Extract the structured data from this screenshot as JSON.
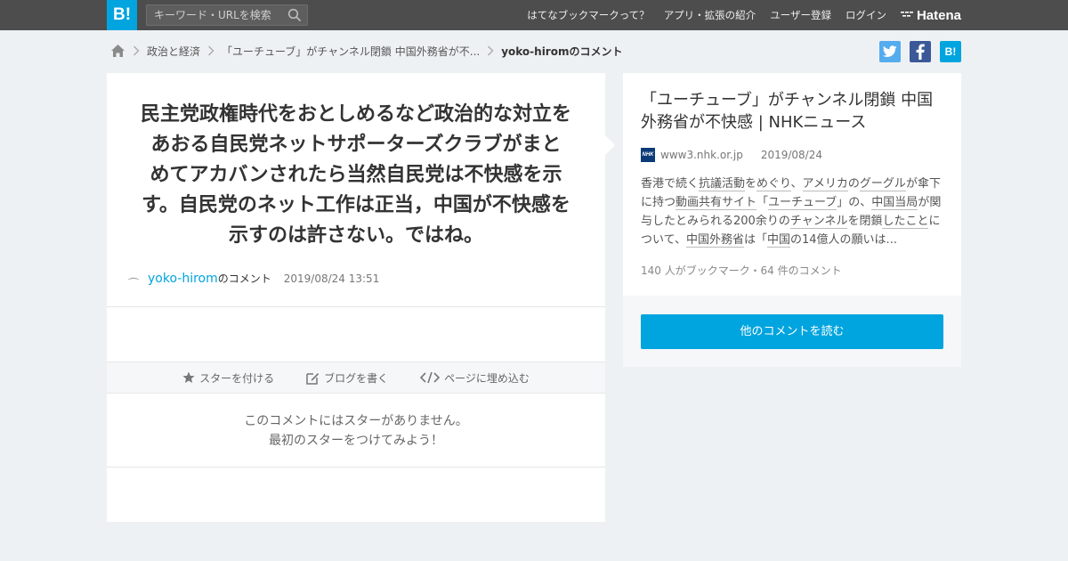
{
  "header": {
    "logo": "B!",
    "search_placeholder": "キーワード・URLを検索",
    "nav": [
      "はてなブックマークって？",
      "アプリ・拡張の紹介",
      "ユーザー登録",
      "ログイン"
    ],
    "brand": "Hatena"
  },
  "breadcrumb": {
    "items": [
      "政治と経済",
      "「ユーチューブ」がチャンネル閉鎖 中国外務省が不..."
    ],
    "current": "yoko-hiromのコメント"
  },
  "share": {
    "twitter": "t",
    "facebook": "f",
    "hatena": "B!"
  },
  "comment": {
    "lines": [
      "民主党政権時代をおとしめるなど政治的な対立を",
      "あおる自民党ネットサポーターズクラブがまと",
      "めてアカバンされたら当然自民党は不快感を示",
      "す。自民党のネット工作は正当，中国が不快感を",
      "示すのは許さない。ではね。"
    ],
    "user": "yoko-hirom",
    "user_suffix": "のコメント",
    "date": "2019/08/24 13:51"
  },
  "actions": {
    "star": "スターを付ける",
    "blog": "ブログを書く",
    "embed": "ページに埋め込む"
  },
  "no_star": {
    "line1": "このコメントにはスターがありません。",
    "line2": "最初のスターをつけてみよう！"
  },
  "entry": {
    "title": "「ユーチューブ」がチャンネル閉鎖 中国外務省が不快感 | NHKニュース",
    "favicon_text": "NHK",
    "site": "www3.nhk.or.jp",
    "date": "2019/08/24",
    "desc": {
      "p1": "香港で続く",
      "l1": "抗議活動",
      "p2": "を",
      "l2": "めぐり",
      "p3": "、",
      "l3": "アメリカ",
      "p4": "の",
      "l4": "グーグル",
      "p5": "が傘下に持つ",
      "l5": "動画共有サイト",
      "p6": "「",
      "l6": "ユーチューブ",
      "p7": "」の、",
      "l7": "中国当局",
      "p8": "が関与したとみられる200余りの",
      "l8": "チャンネル",
      "p9": "を閉鎖",
      "l9": "したこと",
      "p10": "について、",
      "l10": "中国外務省",
      "p11": "は「",
      "l11": "中国",
      "p12": "の14億人の願いは..."
    },
    "counts": "140 人がブックマーク・64 件のコメント",
    "more_button": "他のコメントを読む"
  },
  "colors": {
    "accent": "#00a4de",
    "topbar": "#4d4d4d",
    "twitter": "#55acee",
    "facebook": "#3b5998"
  }
}
